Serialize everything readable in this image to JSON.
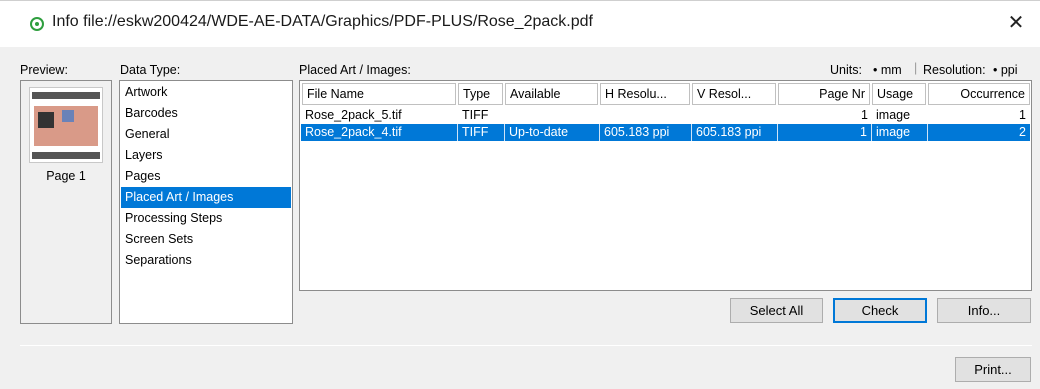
{
  "window": {
    "title": "Info file://eskw200424/WDE-AE-DATA/Graphics/PDF-PLUS/Rose_2pack.pdf",
    "close_glyph": "✕",
    "status_icon": "status-ok-icon",
    "accent_color": "#0078d7"
  },
  "preview": {
    "label": "Preview:",
    "page_label": "Page 1"
  },
  "data_type": {
    "label": "Data Type:",
    "items": [
      {
        "label": "Artwork",
        "selected": false
      },
      {
        "label": "Barcodes",
        "selected": false
      },
      {
        "label": "General",
        "selected": false
      },
      {
        "label": "Layers",
        "selected": false
      },
      {
        "label": "Pages",
        "selected": false
      },
      {
        "label": "Placed Art / Images",
        "selected": true
      },
      {
        "label": "Processing Steps",
        "selected": false
      },
      {
        "label": "Screen Sets",
        "selected": false
      },
      {
        "label": "Separations",
        "selected": false
      }
    ]
  },
  "placed_art": {
    "label": "Placed Art / Images:",
    "units_label": "Units:",
    "units_value": "• mm",
    "resolution_label": "Resolution:",
    "resolution_value": "• ppi",
    "columns": [
      "File Name",
      "Type",
      "Available",
      "H Resolu...",
      "V Resol...",
      "Page Nr",
      "Usage",
      "Occurrence"
    ],
    "rows": [
      {
        "file_name": "Rose_2pack_5.tif",
        "type": "TIFF",
        "available": "",
        "h_res": "",
        "v_res": "",
        "page_nr": "1",
        "usage": "image",
        "occurrence": "1",
        "selected": false
      },
      {
        "file_name": "Rose_2pack_4.tif",
        "type": "TIFF",
        "available": "Up-to-date",
        "h_res": "605.183 ppi",
        "v_res": "605.183 ppi",
        "page_nr": "1",
        "usage": "image",
        "occurrence": "2",
        "selected": true
      }
    ]
  },
  "buttons": {
    "select_all": "Select All",
    "check": "Check",
    "info": "Info...",
    "print": "Print..."
  }
}
